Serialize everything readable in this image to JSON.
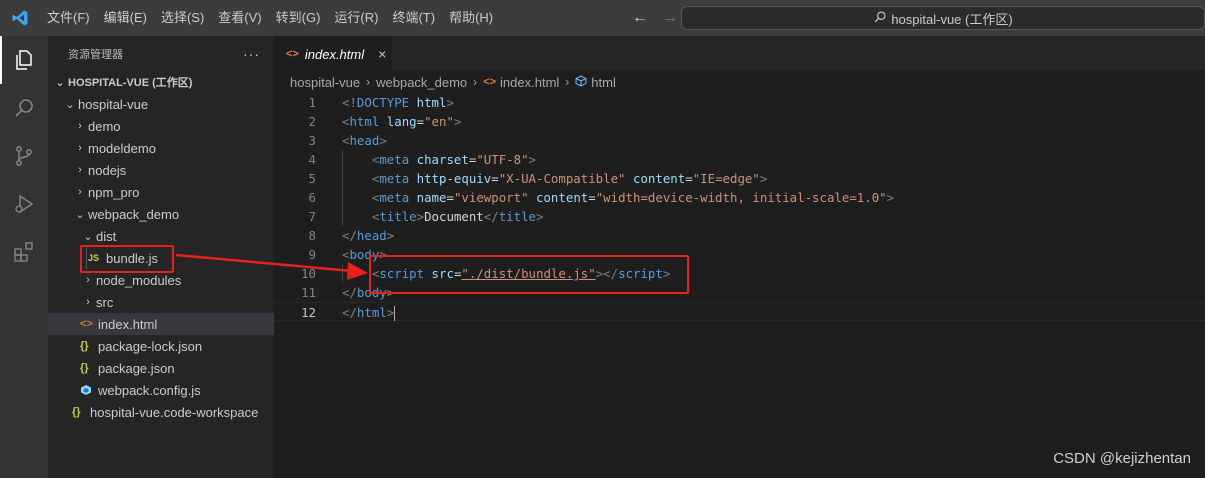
{
  "titlebar": {
    "menu": [
      {
        "label": "文件(F)"
      },
      {
        "label": "编辑(E)"
      },
      {
        "label": "选择(S)"
      },
      {
        "label": "查看(V)"
      },
      {
        "label": "转到(G)"
      },
      {
        "label": "运行(R)"
      },
      {
        "label": "终端(T)"
      },
      {
        "label": "帮助(H)"
      }
    ],
    "search_text": "hospital-vue (工作区)"
  },
  "activitybar": {
    "icons": [
      "explorer-icon",
      "search-icon",
      "source-control-icon",
      "run-debug-icon",
      "extensions-icon"
    ]
  },
  "sidebar": {
    "title": "资源管理器",
    "more": "···",
    "workspace": "HOSPITAL-VUE (工作区)",
    "items": [
      {
        "label": "hospital-vue",
        "type": "folder-open"
      },
      {
        "label": "demo",
        "type": "folder"
      },
      {
        "label": "modeldemo",
        "type": "folder"
      },
      {
        "label": "nodejs",
        "type": "folder"
      },
      {
        "label": "npm_pro",
        "type": "folder"
      },
      {
        "label": "webpack_demo",
        "type": "folder-open"
      },
      {
        "label": "dist",
        "type": "folder-open"
      },
      {
        "label": "bundle.js",
        "type": "js",
        "icon_text": "JS"
      },
      {
        "label": "node_modules",
        "type": "folder"
      },
      {
        "label": "src",
        "type": "folder"
      },
      {
        "label": "index.html",
        "type": "html",
        "icon_text": "<>"
      },
      {
        "label": "package-lock.json",
        "type": "json",
        "icon_text": "{}"
      },
      {
        "label": "package.json",
        "type": "json",
        "icon_text": "{}"
      },
      {
        "label": "webpack.config.js",
        "type": "webpack"
      },
      {
        "label": "hospital-vue.code-workspace",
        "type": "json",
        "icon_text": "{}"
      }
    ]
  },
  "editor": {
    "tab": {
      "label": "index.html",
      "icon_text": "<>",
      "close": "×"
    },
    "breadcrumb": [
      "hospital-vue",
      "webpack_demo",
      "index.html",
      "html"
    ],
    "lines": [
      {
        "n": "1"
      },
      {
        "n": "2"
      },
      {
        "n": "3"
      },
      {
        "n": "4"
      },
      {
        "n": "5"
      },
      {
        "n": "6"
      },
      {
        "n": "7"
      },
      {
        "n": "8"
      },
      {
        "n": "9"
      },
      {
        "n": "10"
      },
      {
        "n": "11"
      },
      {
        "n": "12"
      }
    ],
    "code": {
      "l1": {
        "a": "<!",
        "b": "DOCTYPE",
        "c": " ",
        "d": "html",
        "e": ">"
      },
      "l2": {
        "a": "<",
        "b": "html",
        "c": " ",
        "d": "lang",
        "e": "=",
        "f": "\"en\"",
        "g": ">"
      },
      "l3": {
        "a": "<",
        "b": "head",
        "c": ">"
      },
      "l4": {
        "a": "<",
        "b": "meta",
        "c": " ",
        "d": "charset",
        "e": "=",
        "f": "\"UTF-8\"",
        "g": ">"
      },
      "l5": {
        "a": "<",
        "b": "meta",
        "c": " ",
        "d": "http-equiv",
        "e": "=",
        "f": "\"X-UA-Compatible\"",
        "g": " ",
        "h": "content",
        "i": "=",
        "j": "\"IE=edge\"",
        "k": ">"
      },
      "l6": {
        "a": "<",
        "b": "meta",
        "c": " ",
        "d": "name",
        "e": "=",
        "f": "\"viewport\"",
        "g": " ",
        "h": "content",
        "i": "=",
        "j": "\"width=device-width, initial-scale=1.0\"",
        "k": ">"
      },
      "l7": {
        "a": "<",
        "b": "title",
        "c": ">",
        "d": "Document",
        "e": "</",
        "f": "title",
        "g": ">"
      },
      "l8": {
        "a": "</",
        "b": "head",
        "c": ">"
      },
      "l9": {
        "a": "<",
        "b": "body",
        "c": ">"
      },
      "l10": {
        "a": "<",
        "b": "script",
        "c": " ",
        "d": "src",
        "e": "=",
        "f": "\"./dist/bundle.js\"",
        "g": "></",
        "h": "script",
        "i": ">"
      },
      "l11": {
        "a": "</",
        "b": "body",
        "c": ">"
      },
      "l12": {
        "a": "</",
        "b": "html",
        "c": ">"
      }
    }
  },
  "watermark": "CSDN @kejizhentan",
  "colors": {
    "annotation": "#e8201a",
    "accent": "#569cd6"
  }
}
